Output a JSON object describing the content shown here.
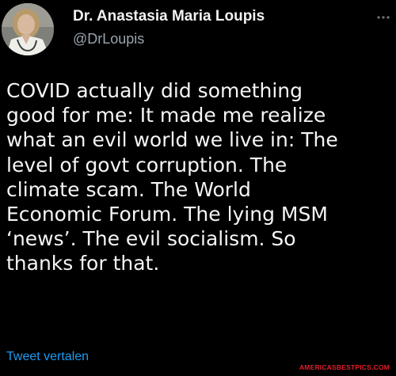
{
  "author": {
    "display_name": "Dr. Anastasia Maria Loupis",
    "handle": "@DrLoupis",
    "avatar_icon": "profile-photo-avatar"
  },
  "tweet": {
    "text_lines": [
      "COVID actually did something",
      "good for me: It made me realize",
      "what an evil world we live in: The",
      "level of govt corruption. The",
      "climate scam. The World",
      "Economic Forum. The lying MSM",
      "‘news’. The evil socialism. So",
      "thanks for that."
    ],
    "translate_label": "Tweet vertalen"
  },
  "more_menu_icon": "more-horizontal-icon",
  "watermark": "AMERICASBESTPICS.COM",
  "colors": {
    "background": "#000000",
    "text": "#f5f5f5",
    "handle": "#9aa4ad",
    "link": "#1d9bf0",
    "watermark": "#e31d2b"
  }
}
